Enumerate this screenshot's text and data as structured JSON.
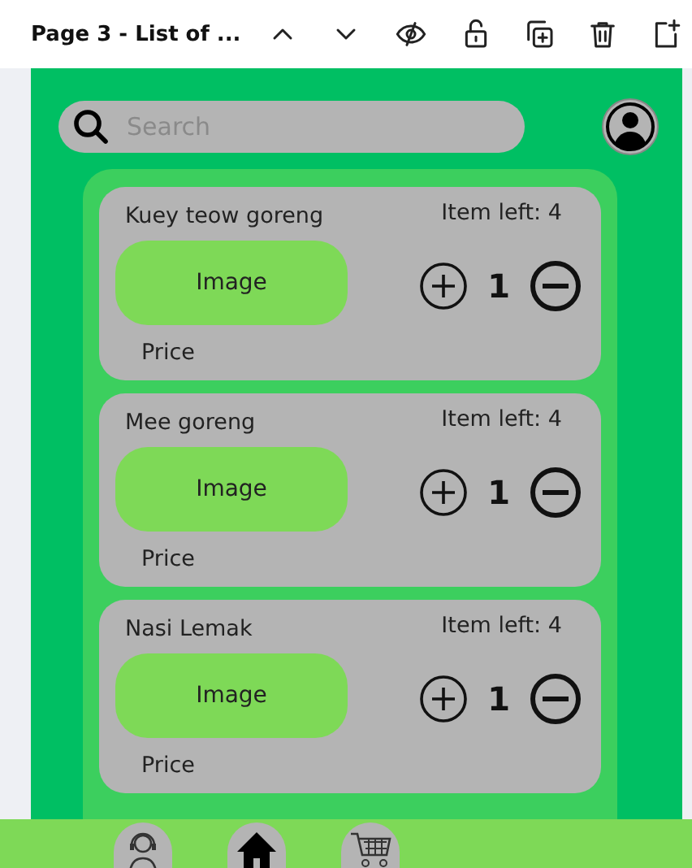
{
  "toolbar": {
    "title": "Page 3 - List of ..."
  },
  "search": {
    "placeholder": "Search"
  },
  "items": [
    {
      "name": "Kuey teow goreng",
      "stock_label": "Item left: 4",
      "image_label": "Image",
      "quantity": "1",
      "price_label": "Price"
    },
    {
      "name": "Mee goreng",
      "stock_label": "Item left: 4",
      "image_label": "Image",
      "quantity": "1",
      "price_label": "Price"
    },
    {
      "name": "Nasi Lemak",
      "stock_label": "Item left: 4",
      "image_label": "Image",
      "quantity": "1",
      "price_label": "Price"
    }
  ],
  "nav": [
    {
      "kind": "support"
    },
    {
      "kind": "home"
    },
    {
      "kind": "cart"
    }
  ]
}
